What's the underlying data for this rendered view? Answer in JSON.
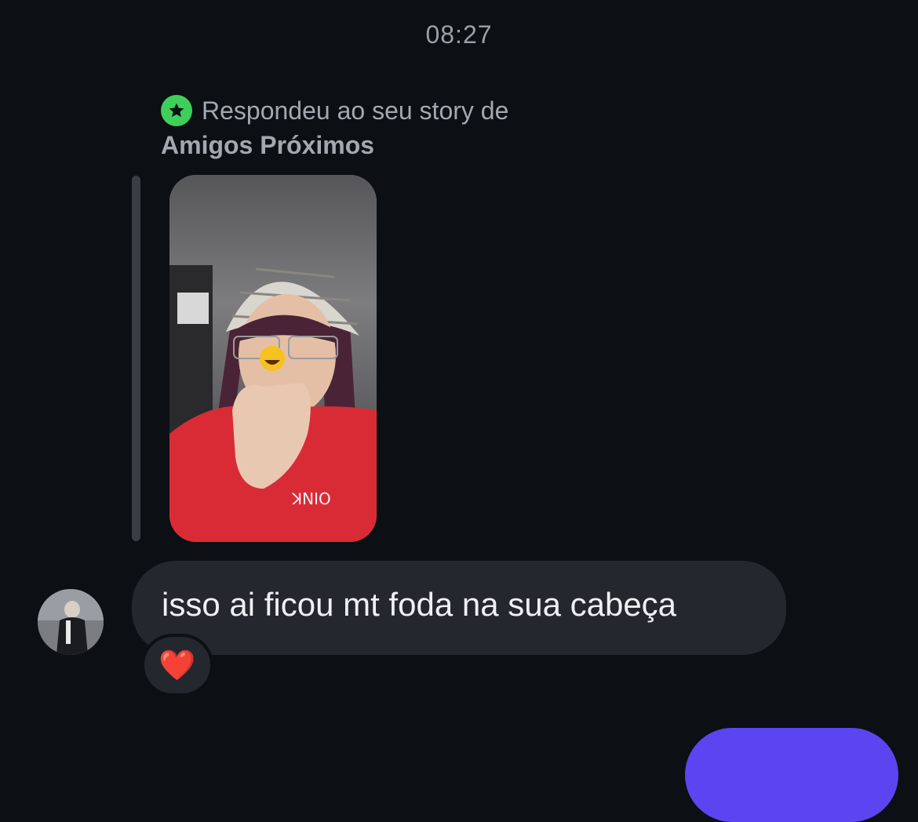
{
  "conversation": {
    "timestamp": "08:27",
    "story_reply": {
      "label": "Respondeu ao seu story de",
      "audience": "Amigos Próximos",
      "badge_icon": "star-icon",
      "badge_color": "#3ecf5b"
    },
    "incoming_message": {
      "text": "isso ai ficou mt foda na sua cabeça",
      "reaction": "❤️"
    },
    "outgoing_bubble_color": "#5b45f0"
  }
}
